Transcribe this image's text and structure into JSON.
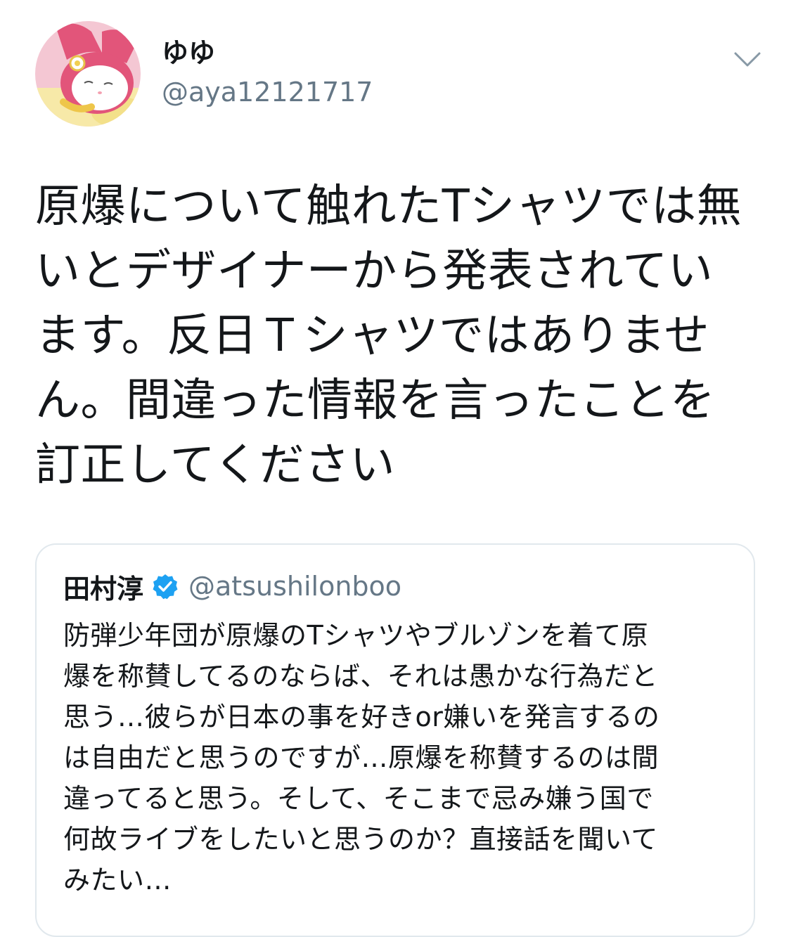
{
  "author": {
    "display_name": "ゆゆ",
    "handle": "@aya12121717",
    "avatar_icon": "pink-bunny-character-avatar"
  },
  "menu": {
    "icon": "chevron-down-icon"
  },
  "tweet": {
    "lines": [
      "原爆について触れたTシャツでは無",
      "いとデザイナーから発表されてい",
      "ます。反日Ｔシャツではありませ",
      "ん。間違った情報を言ったことを",
      "訂正してください"
    ]
  },
  "quote": {
    "display_name": "田村淳",
    "verified": true,
    "verified_icon": "verified-badge-icon",
    "handle": "@atsushilonboo",
    "lines": [
      "防弾少年団が原爆のTシャツやブルゾンを着て原",
      "爆を称賛してるのならば、それは愚かな行為だと",
      "思う…彼らが日本の事を好きor嫌いを発言するの",
      "は自由だと思うのですが…原爆を称賛するのは間",
      "違ってると思う。そして、そこまで忌み嫌う国で",
      "何故ライブをしたいと思うのか？直接話を聞いて",
      "みたい…"
    ]
  },
  "colors": {
    "text_primary": "#14171a",
    "text_secondary": "#657786",
    "border": "#e1e8ed",
    "verified_blue": "#1da1f2",
    "chevron": "#8899a6"
  }
}
